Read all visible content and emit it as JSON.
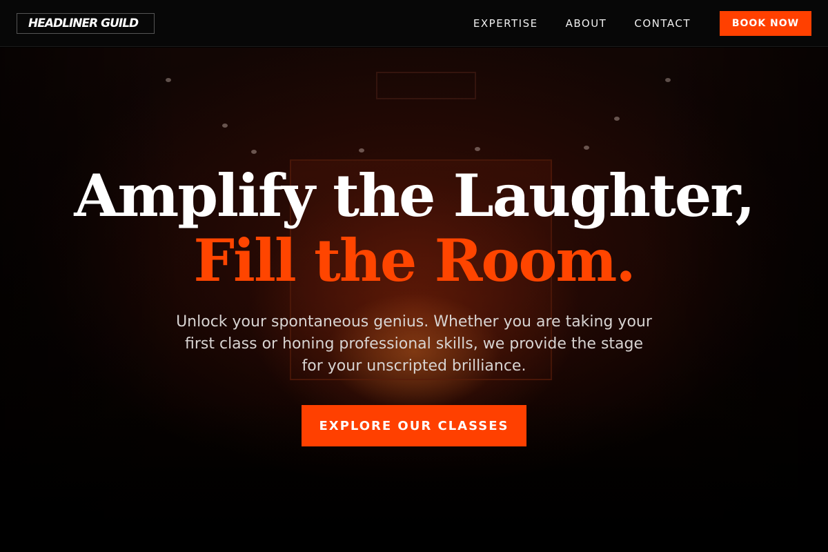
{
  "header": {
    "logo_text": "HEADLINER GUILD",
    "nav": [
      {
        "label": "EXPERTISE"
      },
      {
        "label": "ABOUT"
      },
      {
        "label": "CONTACT"
      }
    ],
    "cta_label": "BOOK NOW"
  },
  "hero": {
    "headline_line1": "Amplify the Laughter,",
    "headline_line2": "Fill the Room.",
    "subtext": "Unlock your spontaneous genius. Whether you are taking your first class or honing professional skills, we provide the stage for your unscripted brilliance.",
    "cta_label": "EXPLORE OUR CLASSES"
  },
  "colors": {
    "accent": "#ff4000",
    "background": "#000000",
    "headline_primary": "#ffffff",
    "headline_accent": "#ff4500"
  }
}
